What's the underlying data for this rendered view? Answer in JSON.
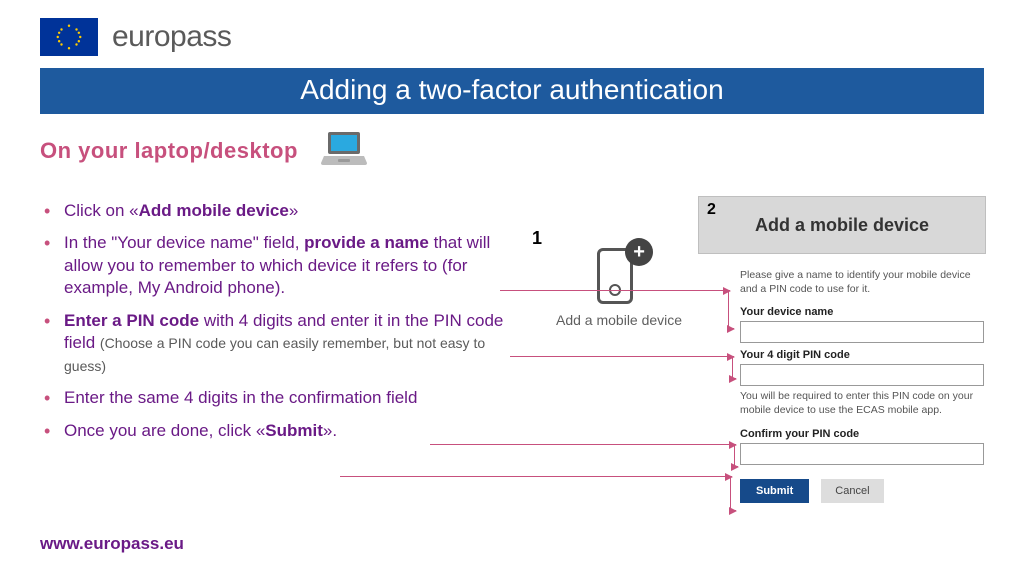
{
  "logo": {
    "brand": "europass"
  },
  "title": "Adding a two-factor authentication",
  "subtitle": "On your laptop/desktop",
  "bullets": {
    "b1_pre": "Click on «",
    "b1_bold": "Add mobile device",
    "b1_post": "»",
    "b2_pre": "In the \"Your device name\" field, ",
    "b2_bold": "provide a name",
    "b2_post": " that will allow you to remember to which device it refers to (for example, My Android phone).",
    "b3_bold": "Enter a PIN code",
    "b3_post": " with 4 digits and enter it in the PIN code field ",
    "b3_note": "(Choose a PIN code you can easily remember, but not easy to guess)",
    "b4": "Enter the same 4 digits in the confirmation field",
    "b5_pre": "Once you are done, click «",
    "b5_bold": "Submit",
    "b5_post": "»."
  },
  "footer_url": "www.europass.eu",
  "callout1": {
    "num": "1",
    "label": "Add a mobile device"
  },
  "callout2": {
    "num": "2",
    "label": "Add a mobile device"
  },
  "form": {
    "intro": "Please give a name to identify your mobile device and a PIN code to use for it.",
    "lbl_device": "Your device name",
    "lbl_pin": "Your 4 digit PIN code",
    "hint_pin": "You will be required to enter this PIN code on your mobile device to use the ECAS mobile app.",
    "lbl_confirm": "Confirm your PIN code",
    "submit": "Submit",
    "cancel": "Cancel"
  }
}
